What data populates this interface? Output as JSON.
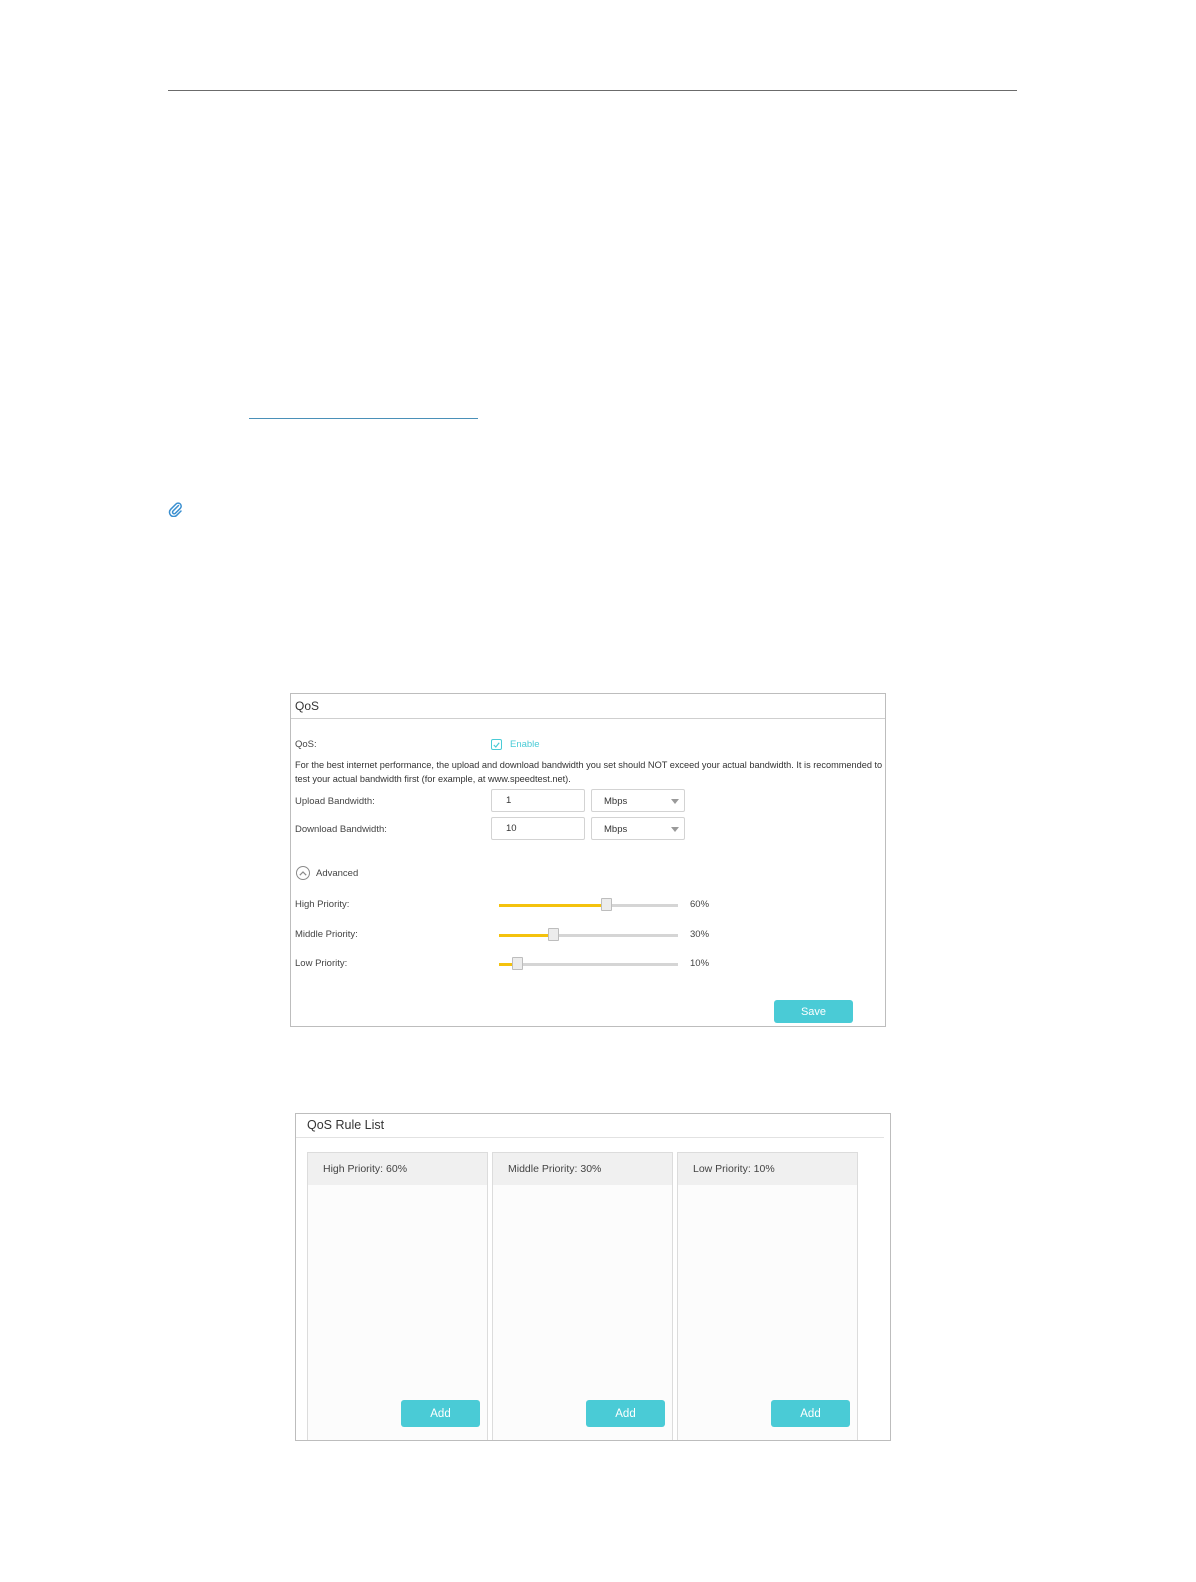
{
  "qos_panel": {
    "title": "QoS",
    "qos_label": "QoS:",
    "enable_label": "Enable",
    "enabled": true,
    "description": "For the best internet performance, the upload and download bandwidth you set should NOT exceed your actual bandwidth. It is recommended to test your actual bandwidth first (for example, at www.speedtest.net).",
    "upload": {
      "label": "Upload Bandwidth:",
      "value": "1",
      "unit": "Mbps"
    },
    "download": {
      "label": "Download Bandwidth:",
      "value": "10",
      "unit": "Mbps"
    },
    "advanced_label": "Advanced",
    "priorities": [
      {
        "label": "High Priority:",
        "percent_text": "60%",
        "fraction": 0.6
      },
      {
        "label": "Middle Priority:",
        "percent_text": "30%",
        "fraction": 0.3
      },
      {
        "label": "Low Priority:",
        "percent_text": "10%",
        "fraction": 0.1
      }
    ],
    "save_label": "Save"
  },
  "rule_list": {
    "title": "QoS Rule List",
    "columns": [
      {
        "header": "High Priority: 60%",
        "add_label": "Add"
      },
      {
        "header": "Middle Priority: 30%",
        "add_label": "Add"
      },
      {
        "header": "Low Priority: 10%",
        "add_label": "Add"
      }
    ]
  },
  "colors": {
    "accent": "#4acbd6",
    "slider_fill": "#f4c20d"
  }
}
